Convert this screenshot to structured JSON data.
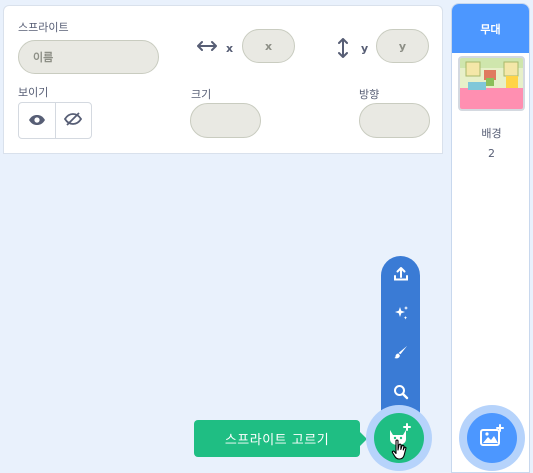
{
  "sprite_info": {
    "sprite_label": "스프라이트",
    "name_placeholder": "이름",
    "x_label": "x",
    "x_placeholder": "x",
    "y_label": "y",
    "y_placeholder": "y",
    "show_label": "보이기",
    "size_label": "크기",
    "direction_label": "방향"
  },
  "stage": {
    "header": "무대",
    "backdrops_label": "배경",
    "backdrops_count": "2"
  },
  "sprite_menu": {
    "items": [
      "upload-icon",
      "surprise-icon",
      "paint-icon",
      "search-icon"
    ],
    "choose_tooltip": "스프라이트 고르기"
  },
  "colors": {
    "accent": "#4c97ff",
    "menu_blue": "#3a7bd5",
    "green": "#1fbe83"
  }
}
